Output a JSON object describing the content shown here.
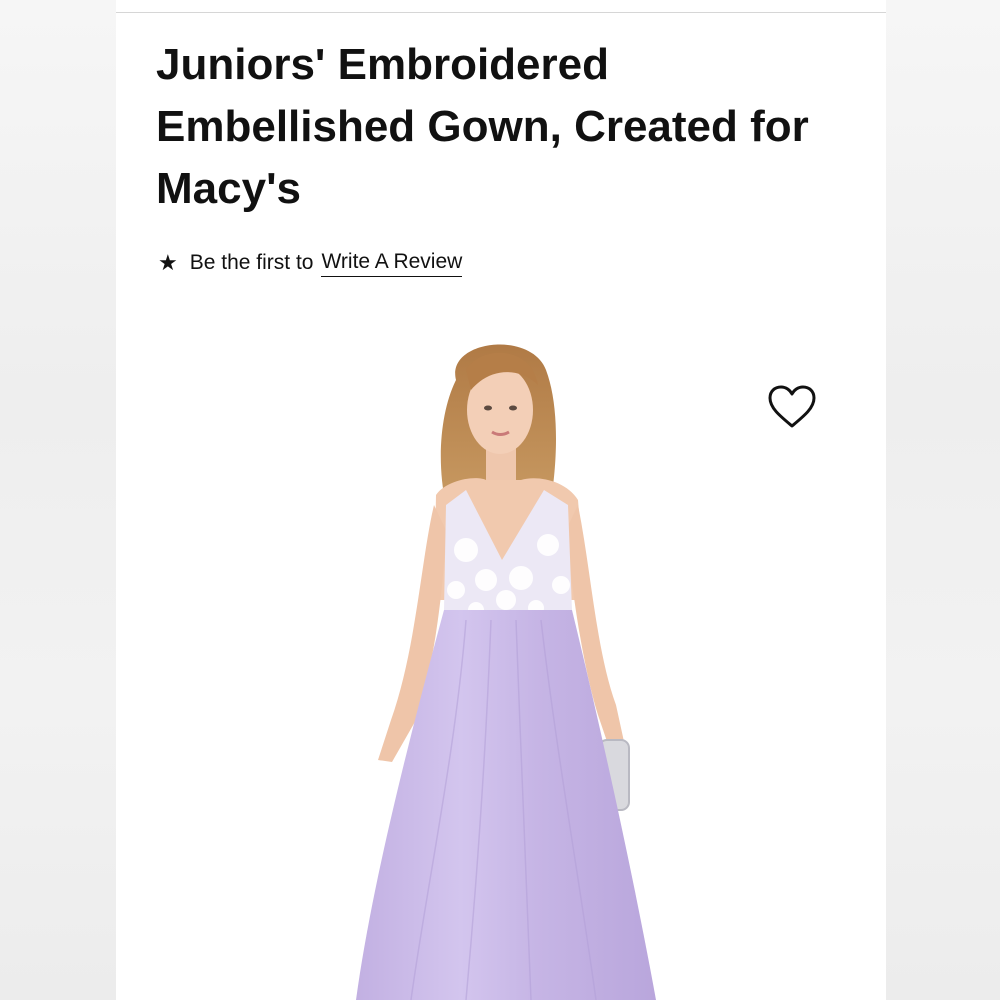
{
  "product": {
    "title": "Juniors' Embroidered Embellished Gown, Created for Macy's",
    "image_alt": "Lavender tulle gown with white floral embroidered bodice",
    "wishlist_icon": "heart-outline-icon"
  },
  "reviews": {
    "star_icon": "★",
    "prefix": "Be the first to",
    "link_label": "Write A Review"
  },
  "colors": {
    "dress_lavender": "#c9b8e6",
    "text": "#111111"
  }
}
